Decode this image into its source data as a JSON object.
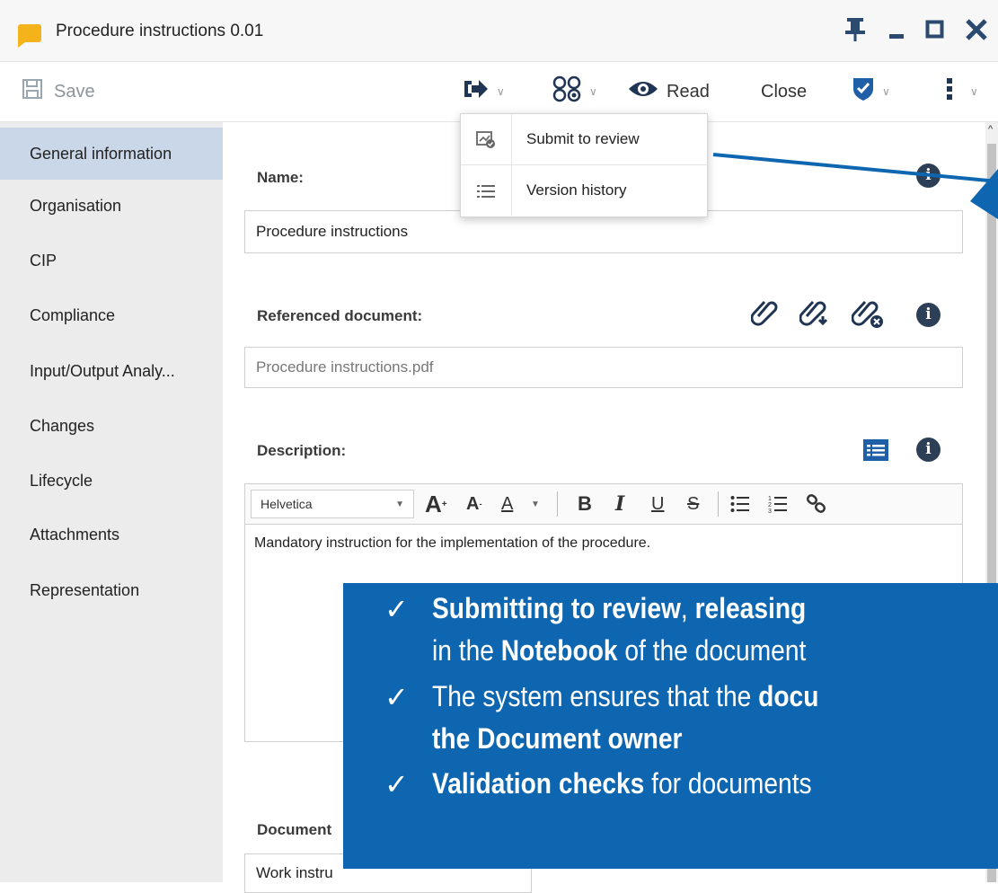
{
  "window": {
    "title": "Procedure instructions 0.01",
    "controls": [
      "pin",
      "minimize",
      "maximize",
      "close"
    ]
  },
  "toolbar": {
    "save_label": "Save",
    "read_label": "Read",
    "close_label": "Close"
  },
  "dropdown": {
    "items": [
      {
        "label": "Submit to review",
        "icon": "submit-review-icon"
      },
      {
        "label": "Version history",
        "icon": "list-icon"
      }
    ]
  },
  "sidebar": {
    "items": [
      {
        "label": "General information",
        "active": true
      },
      {
        "label": "Organisation"
      },
      {
        "label": "CIP"
      },
      {
        "label": "Compliance"
      },
      {
        "label": "Input/Output Analy..."
      },
      {
        "label": "Changes"
      },
      {
        "label": "Lifecycle"
      },
      {
        "label": "Attachments"
      },
      {
        "label": "Representation"
      }
    ]
  },
  "form": {
    "name_label": "Name:",
    "name_value": "Procedure instructions",
    "ref_label": "Referenced document:",
    "ref_value": "Procedure instructions.pdf",
    "desc_label": "Description:",
    "editor": {
      "font": "Helvetica",
      "bold": "B",
      "italic": "I",
      "underline": "U",
      "strike": "S",
      "text": "Mandatory instruction for the implementation of the procedure."
    },
    "doctype_label": "Document",
    "doctype_value": "Work instru"
  },
  "callout": {
    "line1_a": "Submitting to review",
    "line1_b": ", ",
    "line1_c": "releasing",
    "line2_a": "in the ",
    "line2_b": "Notebook",
    "line2_c": " of the document",
    "line3_a": "The system ensures that the ",
    "line3_b": "docu",
    "line4": "the Document owner",
    "line5_a": "Validation checks",
    "line5_b": " for documents",
    "check": "✓"
  },
  "colors": {
    "accent": "#1f5fa8",
    "callout_bg": "#0f66b0",
    "sidebar_active": "#c9d7e8",
    "doc_icon": "#f4b21b"
  }
}
